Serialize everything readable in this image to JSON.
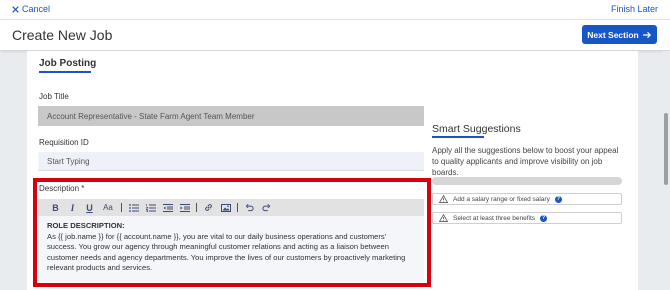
{
  "topbar": {
    "cancel_label": "Cancel",
    "finish_label": "Finish Later"
  },
  "header": {
    "title": "Create New Job",
    "next_label": "Next Section"
  },
  "form": {
    "section_title": "Job Posting",
    "job_title": {
      "label": "Job Title",
      "value": "Account Representative - State Farm Agent Team Member"
    },
    "requisition": {
      "label": "Requisition ID",
      "placeholder": "Start Typing"
    },
    "description": {
      "label": "Description *",
      "heading": "ROLE DESCRIPTION:",
      "body": "As {{ job.name }} for {{ account.name }}, you are vital to our daily business operations and customers' success. You grow our agency through meaningful customer relations and acting as a liaison between customer needs and agency departments. You improve the lives of our customers by proactively marketing relevant products and services."
    },
    "toolbar": {
      "bold": "B",
      "italic": "I",
      "underline": "U",
      "font_size": "Aa"
    }
  },
  "suggestions": {
    "title": "Smart Suggestions",
    "description": "Apply all the suggestions below to boost your appeal to quality applicants and improve visibility on job boards.",
    "progress": 0.0,
    "items": [
      {
        "label": "Add a salary range or fixed salary"
      },
      {
        "label": "Select at least three benefits"
      }
    ]
  },
  "colors": {
    "accent": "#1756c6",
    "highlight": "#d8000c",
    "warning": "#e0a800"
  },
  "icons": [
    "close-icon",
    "arrow-right-icon",
    "bullet-list-icon",
    "numbered-list-icon",
    "outdent-icon",
    "indent-icon",
    "link-icon",
    "image-icon",
    "undo-icon",
    "redo-icon",
    "warning-icon",
    "help-icon"
  ]
}
